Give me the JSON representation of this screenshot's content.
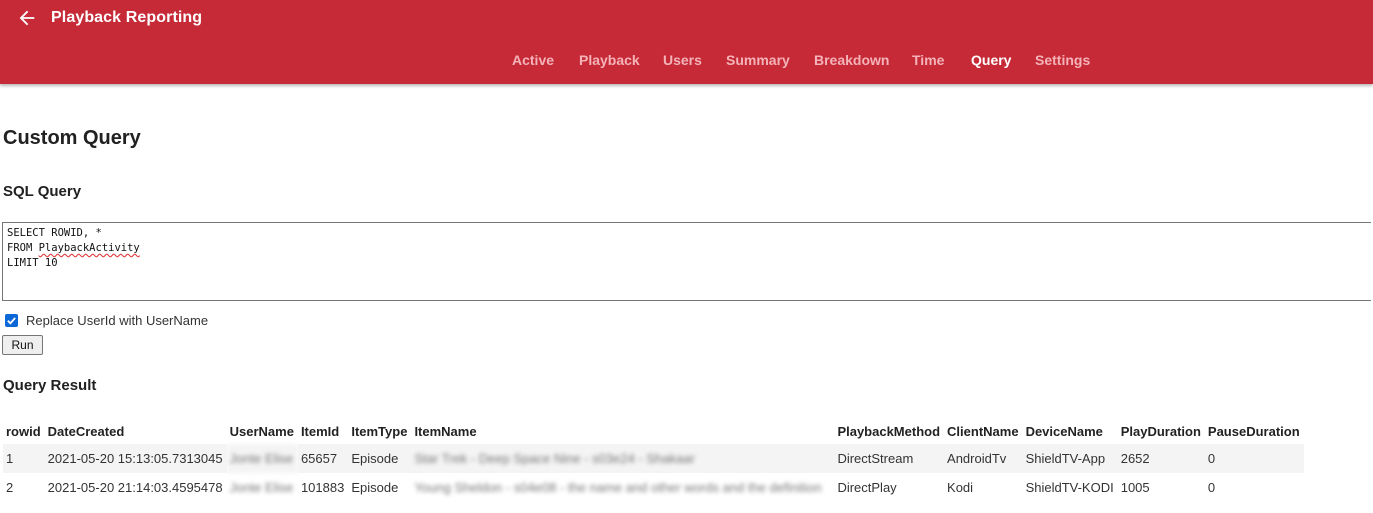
{
  "header": {
    "title": "Playback Reporting",
    "back_icon": "arrow-left-icon",
    "color": "#c62a37",
    "tabs": [
      {
        "label": "Active",
        "active": false
      },
      {
        "label": "Playback",
        "active": false
      },
      {
        "label": "Users",
        "active": false
      },
      {
        "label": "Summary",
        "active": false
      },
      {
        "label": "Breakdown",
        "active": false
      },
      {
        "label": "Time",
        "active": false
      },
      {
        "label": "Query",
        "active": true
      },
      {
        "label": "Settings",
        "active": false
      }
    ]
  },
  "page": {
    "title": "Custom Query",
    "sql_section_title": "SQL Query",
    "sql": {
      "line1": "SELECT ROWID, *",
      "line2_prefix": "FROM ",
      "line2_table": "PlaybackActivity",
      "line3": "LIMIT 10"
    },
    "replace_userid": {
      "label": "Replace UserId with UserName",
      "checked": true
    },
    "run_label": "Run",
    "result_title": "Query Result"
  },
  "results": {
    "columns": [
      "rowid",
      "DateCreated",
      "UserName",
      "ItemId",
      "ItemType",
      "ItemName",
      "PlaybackMethod",
      "ClientName",
      "DeviceName",
      "PlayDuration",
      "PauseDuration"
    ],
    "rows": [
      {
        "rowid": "1",
        "DateCreated": "2021-05-20 15:13:05.7313045",
        "UserName": "Jonte Elise",
        "ItemId": "65657",
        "ItemType": "Episode",
        "ItemName": "Star Trek - Deep Space Nine - s03e24 - Shakaar",
        "PlaybackMethod": "DirectStream",
        "ClientName": "AndroidTv",
        "DeviceName": "ShieldTV-App",
        "PlayDuration": "2652",
        "PauseDuration": "0"
      },
      {
        "rowid": "2",
        "DateCreated": "2021-05-20 21:14:03.4595478",
        "UserName": "Jonte Elise",
        "ItemId": "101883",
        "ItemType": "Episode",
        "ItemName": "Young Sheldon - s04e08 - the name and other words and the definition",
        "PlaybackMethod": "DirectPlay",
        "ClientName": "Kodi",
        "DeviceName": "ShieldTV-KODI",
        "PlayDuration": "1005",
        "PauseDuration": "0"
      }
    ]
  }
}
